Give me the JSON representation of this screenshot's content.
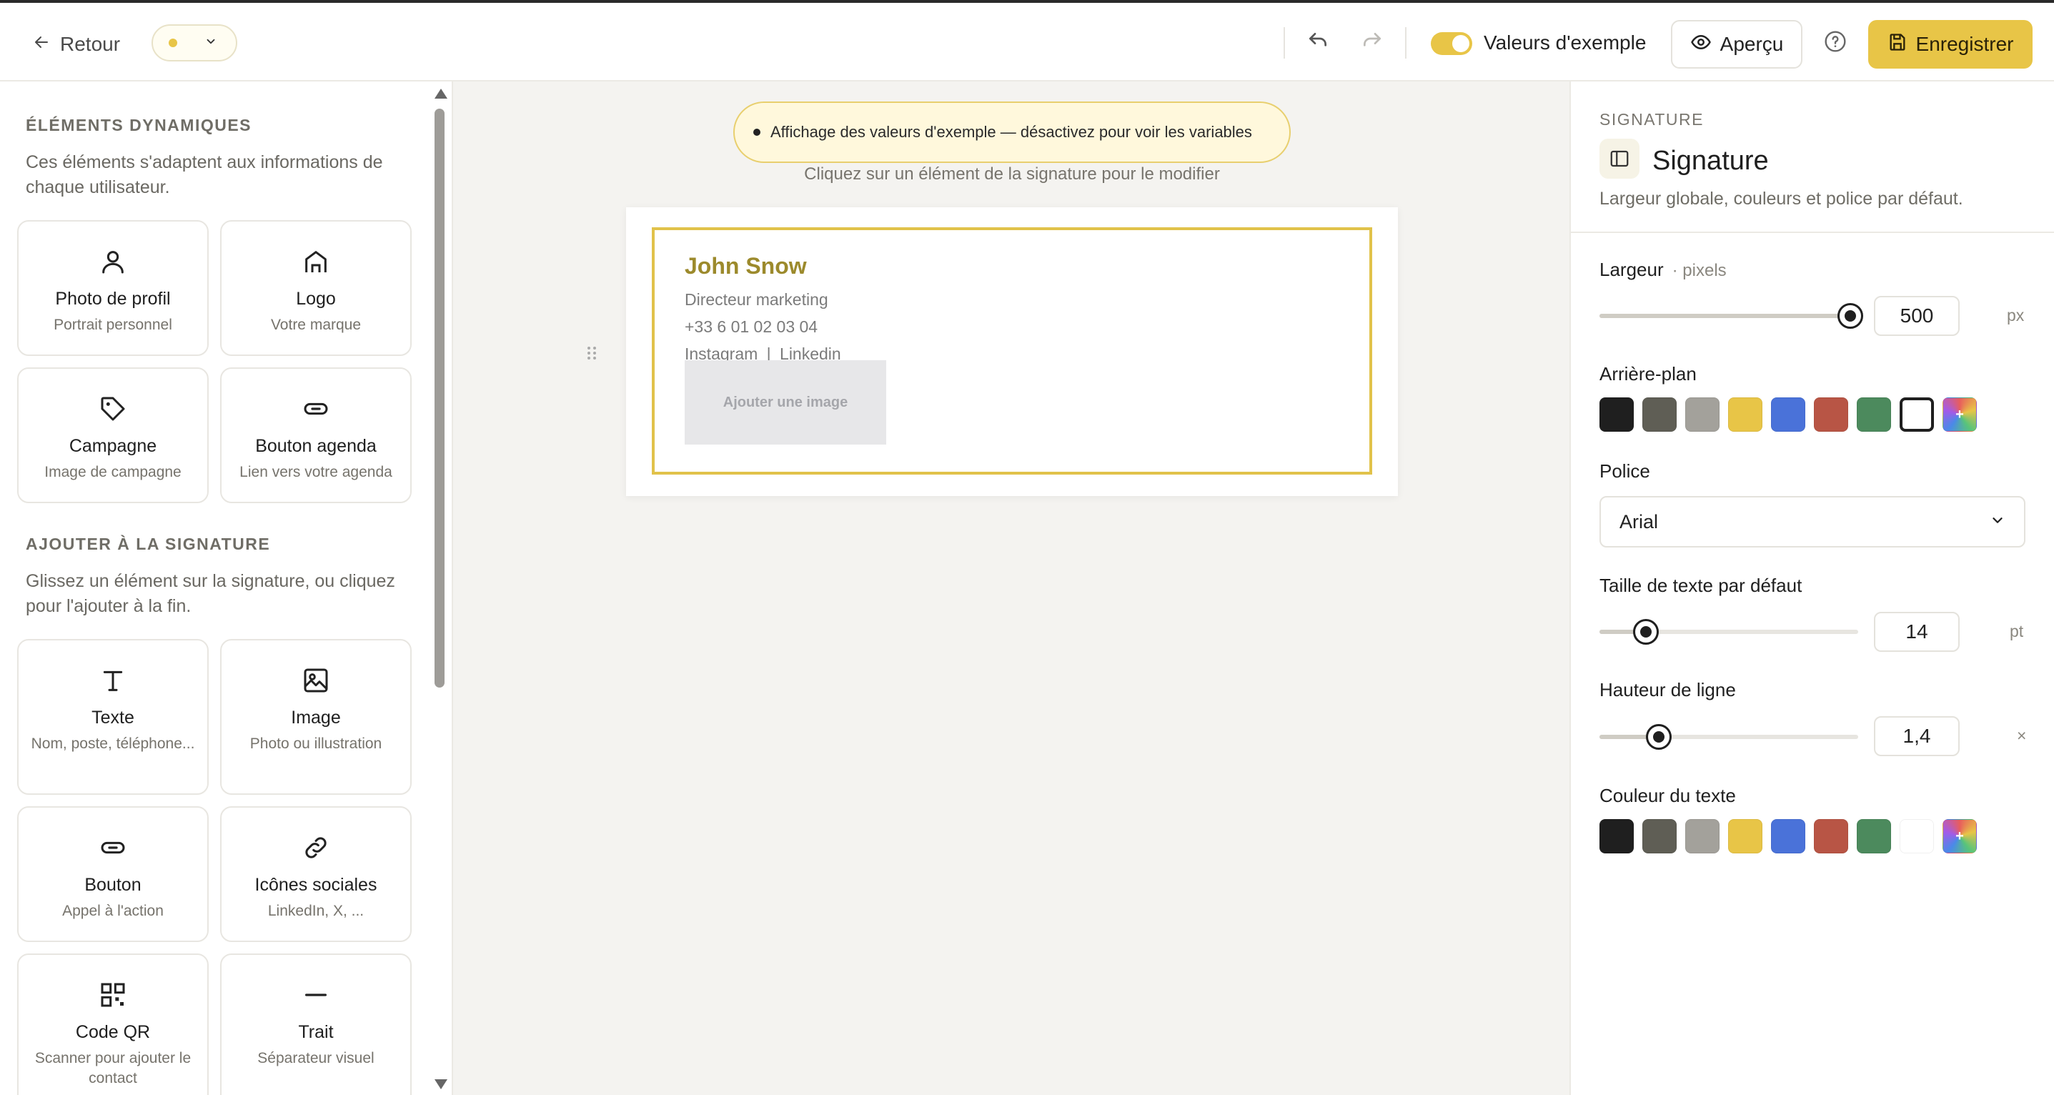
{
  "topbar": {
    "back_label": "Retour",
    "toggle_label": "Valeurs d'exemple",
    "toggle_on": true,
    "preview_label": "Aperçu",
    "save_label": "Enregistrer",
    "accent_color": "#e8c547"
  },
  "sidebar": {
    "dynamic_title": "ÉLÉMENTS DYNAMIQUES",
    "dynamic_desc": "Ces éléments s'adaptent aux informations de chaque utilisateur.",
    "dynamic_items": [
      {
        "title": "Photo de profil",
        "subtitle": "Portrait personnel",
        "icon": "user-icon"
      },
      {
        "title": "Logo",
        "subtitle": "Votre marque",
        "icon": "storefront-icon"
      },
      {
        "title": "Campagne",
        "subtitle": "Image de campagne",
        "icon": "tag-icon"
      },
      {
        "title": "Bouton agenda",
        "subtitle": "Lien vers votre agenda",
        "icon": "button-pill-icon"
      }
    ],
    "add_title": "AJOUTER À LA SIGNATURE",
    "add_desc": "Glissez un élément sur la signature, ou cliquez pour l'ajouter à la fin.",
    "add_items": [
      {
        "title": "Texte",
        "subtitle": "Nom, poste, téléphone...",
        "icon": "text-icon"
      },
      {
        "title": "Image",
        "subtitle": "Photo ou illustration",
        "icon": "image-icon"
      },
      {
        "title": "Bouton",
        "subtitle": "Appel à l'action",
        "icon": "button-pill-icon"
      },
      {
        "title": "Icônes sociales",
        "subtitle": "LinkedIn, X, ...",
        "icon": "link-icon"
      },
      {
        "title": "Code QR",
        "subtitle": "Scanner pour ajouter le contact",
        "icon": "qr-code-icon"
      },
      {
        "title": "Trait",
        "subtitle": "Séparateur visuel",
        "icon": "divider-line-icon"
      }
    ]
  },
  "canvas": {
    "banner_text": "Affichage des valeurs d'exemple — désactivez pour voir les variables",
    "click_hint": "Cliquez sur un élément de la signature pour le modifier",
    "signature": {
      "name": "John Snow",
      "role": "Directeur marketing",
      "phone": "+33 6 01 02 03 04",
      "social_1": "Instagram",
      "social_sep": "|",
      "social_2": "Linkedin",
      "image_placeholder": "Ajouter une image",
      "name_color": "#9c8a2c",
      "frame_color": "#e1c24a"
    }
  },
  "panel": {
    "kicker": "SIGNATURE",
    "title": "Signature",
    "description": "Largeur globale, couleurs et police par défaut.",
    "width": {
      "label": "Largeur",
      "unit_hint": "· pixels",
      "value": "500",
      "unit": "px",
      "slider_fraction": 0.97
    },
    "background": {
      "label": "Arrière-plan",
      "selected_index": 7
    },
    "font": {
      "label": "Police",
      "value": "Arial"
    },
    "text_size": {
      "label": "Taille de texte par défaut",
      "value": "14",
      "unit": "pt",
      "slider_fraction": 0.18
    },
    "line_height": {
      "label": "Hauteur de ligne",
      "value": "1,4",
      "unit": "×",
      "slider_fraction": 0.23
    },
    "text_color": {
      "label": "Couleur du texte"
    },
    "swatch_colors": [
      "#1f1f1f",
      "#5f5e55",
      "#a3a19b",
      "#e8c547",
      "#4a72d9",
      "#b85545",
      "#4c8a5d",
      "#ffffff"
    ]
  }
}
